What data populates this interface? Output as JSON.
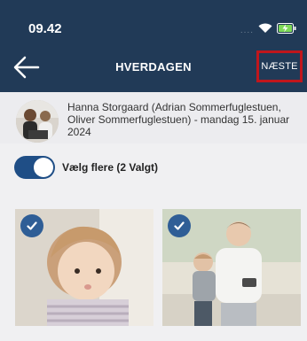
{
  "status": {
    "time": "09.42",
    "signal_dots": "...."
  },
  "nav": {
    "title": "HVERDAGEN",
    "next_label": "NÆSTE",
    "back_icon": "arrow-left-icon"
  },
  "post": {
    "info": "Hanna Storgaard (Adrian Sommerfuglestuen, Oliver Sommerfuglestuen) - mandag 15. januar 2024"
  },
  "select": {
    "label": "Vælg flere (2 Valgt)",
    "enabled": true
  },
  "photos": [
    {
      "selected": true
    },
    {
      "selected": true
    }
  ],
  "colors": {
    "header": "#213a57",
    "accent": "#2f5e96",
    "highlight": "#c0161c"
  }
}
